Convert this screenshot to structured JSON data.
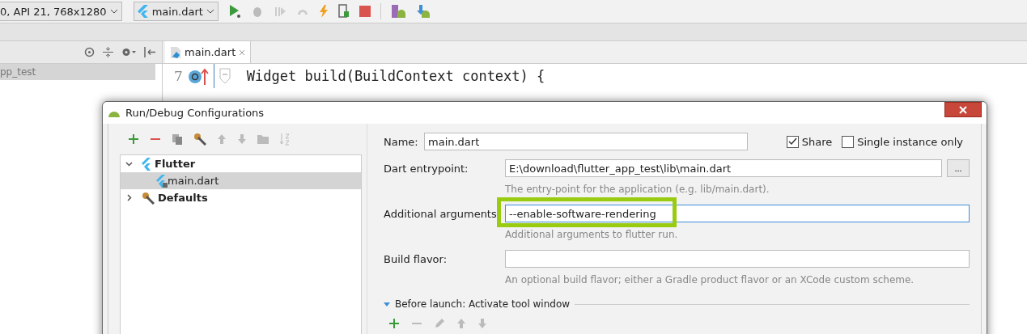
{
  "toolbar": {
    "device_selector": "0, API 21, 768x1280",
    "config_selector": "main.dart"
  },
  "project_panel": {
    "item": "pp_test"
  },
  "editor": {
    "tabs": [
      {
        "label": "main.dart",
        "selected": true
      }
    ],
    "line_number": "7",
    "code": "Widget build(BuildContext context) {"
  },
  "dialog": {
    "title": "Run/Debug Configurations",
    "tree": [
      {
        "label": "Flutter",
        "kind": "flutter",
        "expanded": true,
        "selected": false,
        "children": [
          {
            "label": "main.dart",
            "kind": "config",
            "selected": true
          }
        ]
      },
      {
        "label": "Defaults",
        "kind": "defaults",
        "expanded": false,
        "selected": false
      }
    ],
    "name_field": {
      "label": "Name:",
      "value": "main.dart"
    },
    "share": {
      "label": "Share",
      "checked": true
    },
    "single_instance": {
      "label": "Single instance only",
      "checked": false
    },
    "fields": [
      {
        "label": "Dart entrypoint:",
        "value": "E:\\download\\flutter_app_test\\lib\\main.dart",
        "hint": "The entry-point for the application (e.g. lib/main.dart).",
        "browse": "...",
        "highlighted": false
      },
      {
        "label": "Additional arguments",
        "value": "--enable-software-rendering",
        "hint": "Additional arguments to flutter run.",
        "highlighted": true
      },
      {
        "label": "Build flavor:",
        "hint": "An optional build flavor; either a Gradle product flavor or an XCode custom scheme.",
        "highlighted": false
      }
    ],
    "before_launch": {
      "label": "Before launch: Activate tool window",
      "expanded": true
    }
  }
}
